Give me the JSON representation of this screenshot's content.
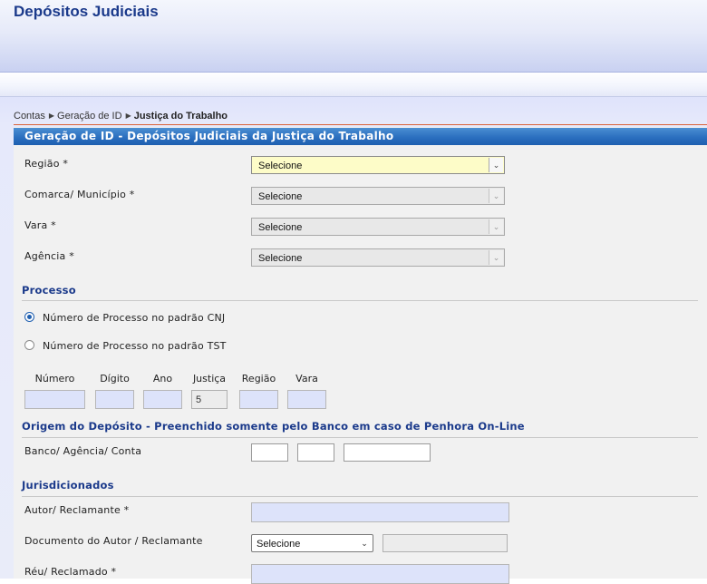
{
  "app": {
    "title": "Depósitos Judiciais"
  },
  "breadcrumb": {
    "items": [
      "Contas",
      "Geração de ID"
    ],
    "current": "Justiça do Trabalho"
  },
  "form": {
    "header": "Geração de ID - Depósitos Judiciais da Justiça do Trabalho",
    "regiao": {
      "label": "Região *",
      "value": "Selecione"
    },
    "comarca": {
      "label": "Comarca/ Município *",
      "value": "Selecione"
    },
    "vara": {
      "label": "Vara *",
      "value": "Selecione"
    },
    "agencia": {
      "label": "Agência *",
      "value": "Selecione"
    }
  },
  "processo": {
    "title": "Processo",
    "radio_cnj": {
      "label": "Número de Processo no padrão CNJ",
      "checked": true
    },
    "radio_tst": {
      "label": "Número de Processo no padrão TST",
      "checked": false
    },
    "columns": {
      "numero": "Número",
      "digito": "Dígito",
      "ano": "Ano",
      "justica": "Justiça",
      "regiao": "Região",
      "vara": "Vara"
    },
    "values": {
      "numero": "",
      "digito": "",
      "ano": "",
      "justica": "5",
      "regiao": "",
      "vara": ""
    }
  },
  "origem": {
    "title": "Origem do Depósito - Preenchido somente pelo Banco em caso de Penhora On-Line",
    "banco_label": "Banco/ Agência/ Conta",
    "banco": "",
    "agencia": "",
    "conta": ""
  },
  "jurisdicionados": {
    "title": "Jurisdicionados",
    "autor_label": "Autor/ Reclamante *",
    "autor_value": "",
    "documento_label": "Documento do Autor / Reclamante",
    "documento_select": "Selecione",
    "documento_value": "",
    "reu_label": "Réu/ Reclamado *",
    "reu_value": ""
  },
  "icons": {
    "dropdown": "chevron-down-icon",
    "breadcrumb_sep": "triangle-right-icon"
  },
  "colors": {
    "brand": "#1b3a8b",
    "header": "#2b6fbf",
    "accent_line": "#d9623a",
    "active_select": "#fdfcc8",
    "field_fill": "#dde3fa"
  }
}
